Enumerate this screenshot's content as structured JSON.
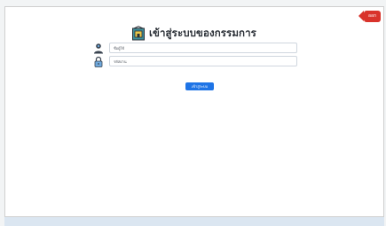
{
  "header": {
    "title": "เข้าสู่ระบบของกรรมการ",
    "exit_label": "ออก"
  },
  "form": {
    "username": {
      "placeholder": "ชื่อผู้ใช้",
      "value": ""
    },
    "password": {
      "placeholder": "รหัสผ่าน",
      "value": ""
    },
    "login_label": "เข้าสู่ระบบ"
  },
  "icons": {
    "title": "building-login-icon",
    "username": "user-icon",
    "password": "lock-icon"
  },
  "colors": {
    "login_button": "#1e74e6",
    "exit_button": "#d9332b",
    "page_background": "#ffffff",
    "bottom_strip": "#dbe6f1"
  }
}
